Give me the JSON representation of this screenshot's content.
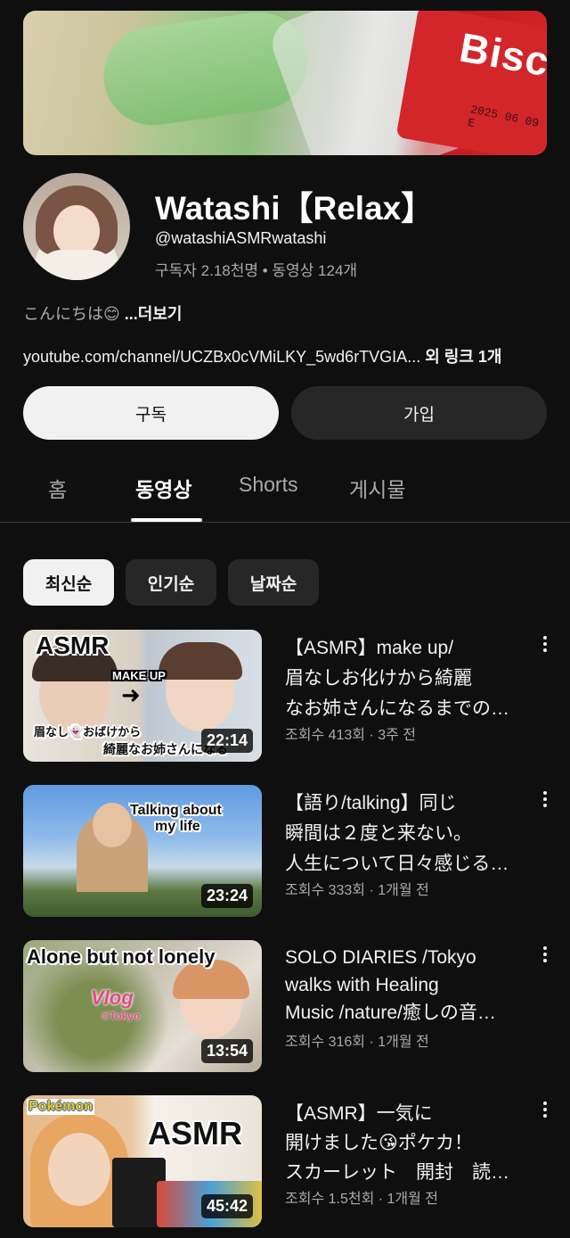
{
  "banner": {
    "brand_text": "Bisc",
    "date_stamp": "2025 06 09 E"
  },
  "channel": {
    "title": "Watashi【Relax】",
    "handle": "@watashiASMRwatashi",
    "stats": "구독자 2.18천명 • 동영상 124개",
    "description": "こんにちは😊",
    "more_label": " ...더보기",
    "link": "youtube.com/channel/UCZBx0cVMiLKY_5wd6rTVGIA...",
    "link_extra": " 외 링크 1개"
  },
  "buttons": {
    "subscribe": "구독",
    "join": "가입"
  },
  "tabs": [
    {
      "label": "홈",
      "active": false
    },
    {
      "label": "동영상",
      "active": true
    },
    {
      "label": "Shorts",
      "active": false
    },
    {
      "label": "게시물",
      "active": false
    }
  ],
  "chips": [
    {
      "label": "최신순",
      "selected": true
    },
    {
      "label": "인기순",
      "selected": false
    },
    {
      "label": "날짜순",
      "selected": false
    }
  ],
  "videos": [
    {
      "title_lines": [
        "【ASMR】make up/",
        "眉なしお化けから綺麗",
        "なお姉さんになるまでの…"
      ],
      "meta": "조회수 413회 · 3주 전",
      "duration": "22:14",
      "overlay": {
        "a": "ASMR",
        "b": "MAKE UP",
        "c": "眉なし👻おばけから",
        "d": "綺麗なお姉さんになる"
      }
    },
    {
      "title_lines": [
        "【語り/talking】同じ",
        "瞬間は２度と来ない。",
        "人生について日々感じる…"
      ],
      "meta": "조회수 333회 · 1개월 전",
      "duration": "23:24",
      "overlay": {
        "a": "Talking about",
        "b": "my life"
      }
    },
    {
      "title_lines": [
        "SOLO DIARIES /Tokyo",
        "walks with Healing",
        "Music /nature/癒しの音…"
      ],
      "meta": "조회수 316회 · 1개월 전",
      "duration": "13:54",
      "overlay": {
        "a": "Alone but not lonely",
        "b": "Vlog",
        "c": "©Tokyo"
      }
    },
    {
      "title_lines": [
        "【ASMR】一気に",
        "開けました😘ポケカ！",
        "スカーレット　開封　読…"
      ],
      "meta": "조회수 1.5천회 · 1개월 전",
      "duration": "45:42",
      "overlay": {
        "a": "Pokémon",
        "b": "ASMR"
      }
    }
  ]
}
